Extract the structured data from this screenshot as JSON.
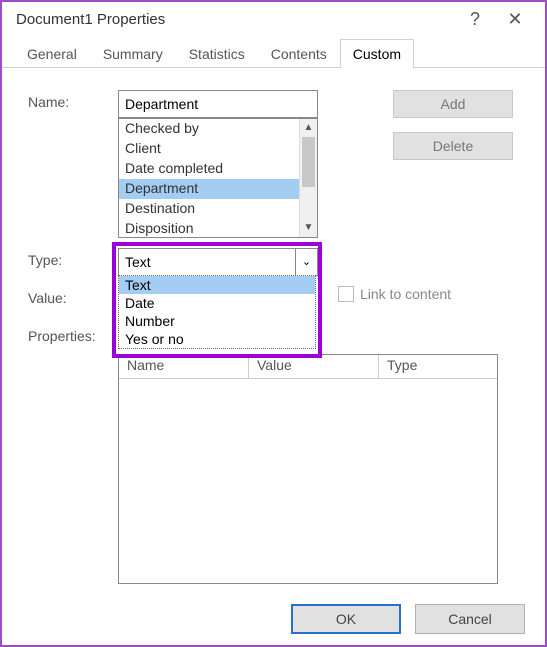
{
  "window": {
    "title": "Document1 Properties",
    "help_glyph": "?",
    "close_glyph": "✕"
  },
  "tabs": {
    "items": [
      "General",
      "Summary",
      "Statistics",
      "Contents",
      "Custom"
    ],
    "active_index": 4
  },
  "labels": {
    "name": "Name:",
    "type": "Type:",
    "value": "Value:",
    "properties": "Properties:",
    "link_to_content": "Link to content"
  },
  "name_field": "Department",
  "name_options": [
    "Checked by",
    "Client",
    "Date completed",
    "Department",
    "Destination",
    "Disposition"
  ],
  "name_selected_index": 3,
  "buttons": {
    "add": "Add",
    "delete": "Delete",
    "ok": "OK",
    "cancel": "Cancel"
  },
  "type_value": "Text",
  "type_options": [
    "Text",
    "Date",
    "Number",
    "Yes or no"
  ],
  "type_highlight_index": 0,
  "link_checked": false,
  "props_columns": [
    "Name",
    "Value",
    "Type"
  ],
  "scroll_glyphs": {
    "up": "▲",
    "down": "▼"
  },
  "chevron_down": "⌄"
}
